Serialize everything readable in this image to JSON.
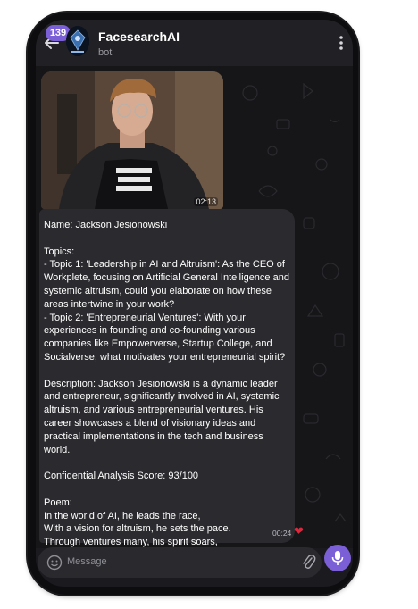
{
  "header": {
    "unread_count": "139",
    "chat_title": "FacesearchAI",
    "chat_subtitle": "bot",
    "back_icon": "arrow-left-icon",
    "menu_icon": "vertical-dots-icon"
  },
  "media": {
    "duration": "02:13"
  },
  "message": {
    "text": "Name: Jackson Jesionowski\n\nTopics:\n- Topic 1: 'Leadership in AI and Altruism': As the CEO of Workplete, focusing on Artificial General Intelligence and systemic altruism, could you elaborate on how these areas intertwine in your work?\n- Topic 2: 'Entrepreneurial Ventures': With your experiences in founding and co-founding various companies like Empowerverse, Startup College, and Socialverse, what motivates your entrepreneurial spirit?\n\nDescription: Jackson Jesionowski is a dynamic leader and entrepreneur, significantly involved in AI, systemic altruism, and various entrepreneurial ventures. His career showcases a blend of visionary ideas and practical implementations in the tech and business world.\n\nConfidential Analysis Score: 93/100\n\nPoem:\nIn the world of AI, he leads the race,\nWith a vision for altruism, he sets the pace.\nThrough ventures many, his spirit soars,\nCrafting a future, opening new doors.",
    "time": "00:24",
    "reaction": "❤"
  },
  "composer": {
    "placeholder": "Message",
    "emoji_icon": "emoji-icon",
    "attach_icon": "paperclip-icon",
    "mic_icon": "microphone-icon"
  },
  "colors": {
    "accent": "#7b5fd6",
    "bubble": "#2b2b2f",
    "header": "#212125",
    "reaction": "#e0263a"
  }
}
